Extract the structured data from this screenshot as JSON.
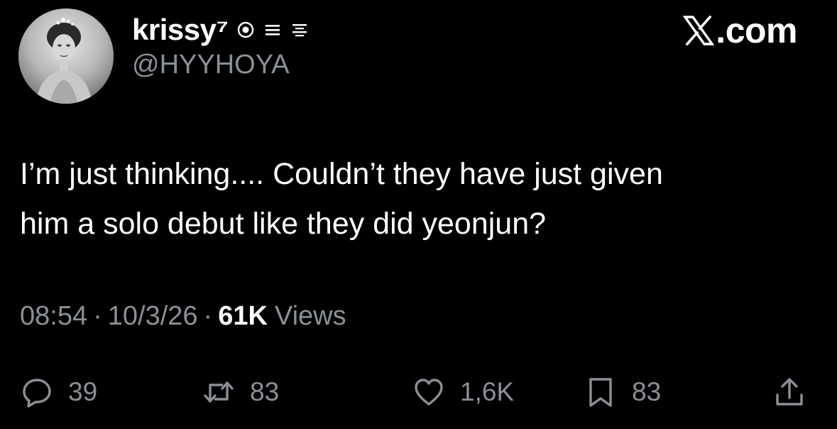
{
  "author": {
    "display_name": "krissy⁷",
    "handle": "@HYYHOYA"
  },
  "brand": {
    "label": ".com"
  },
  "tweet": {
    "text_line_1": "I’m just thinking.... Couldn’t they have just given",
    "text_line_2": "him a solo debut like they did yeonjun?",
    "time": "08:54",
    "date": "10/3/26",
    "views_count": "61K",
    "views_label": "Views",
    "separator": "·"
  },
  "actions": {
    "replies": "39",
    "reposts": "83",
    "likes": "1,6K",
    "bookmarks": "83"
  },
  "icons": {
    "badges": [
      "target-icon",
      "menu-icon",
      "list-icon"
    ],
    "reply": "reply-icon",
    "repost": "repost-icon",
    "like": "heart-icon",
    "bookmark": "bookmark-icon",
    "share": "share-icon"
  },
  "colors": {
    "background": "#000000",
    "primary_text": "#ffffff",
    "secondary_text": "#8b9096"
  }
}
